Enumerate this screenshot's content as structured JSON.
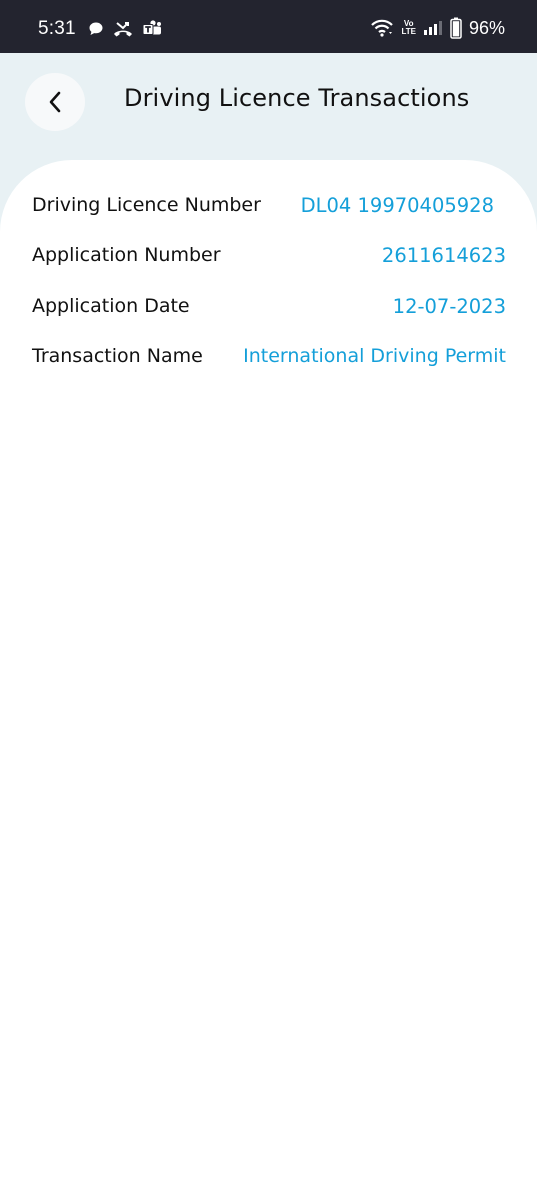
{
  "status_bar": {
    "time": "5:31",
    "battery_percent": "96%",
    "network_label_top": "Vo",
    "network_label_bottom": "LTE",
    "icons": [
      "chat-bubble-icon",
      "missed-call-icon",
      "teams-icon",
      "wifi-icon",
      "signal-icon",
      "battery-icon"
    ]
  },
  "header": {
    "title": "Driving Licence Transactions",
    "back_icon": "chevron-left-icon"
  },
  "details": [
    {
      "label": "Driving Licence Number",
      "value": "DL04 19970405928"
    },
    {
      "label": "Application Number",
      "value": "2611614623"
    },
    {
      "label": "Application Date",
      "value": "12-07-2023"
    },
    {
      "label": "Transaction Name",
      "value": "International Driving Permit"
    }
  ],
  "colors": {
    "status_bar": "#23242f",
    "header_background": "#e8f1f4",
    "value_text": "#149fd9",
    "label_text": "#111111"
  }
}
